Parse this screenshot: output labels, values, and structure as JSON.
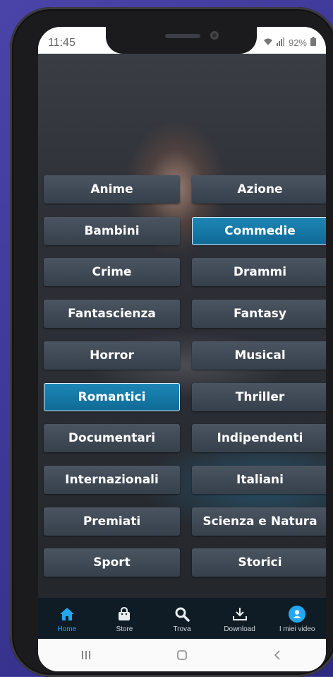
{
  "status": {
    "time": "11:45",
    "battery": "92%"
  },
  "genres": [
    {
      "label": "Anime",
      "selected": false
    },
    {
      "label": "Azione",
      "selected": false
    },
    {
      "label": "Bambini",
      "selected": false
    },
    {
      "label": "Commedie",
      "selected": true
    },
    {
      "label": "Crime",
      "selected": false
    },
    {
      "label": "Drammi",
      "selected": false
    },
    {
      "label": "Fantascienza",
      "selected": false
    },
    {
      "label": "Fantasy",
      "selected": false
    },
    {
      "label": "Horror",
      "selected": false
    },
    {
      "label": "Musical",
      "selected": false
    },
    {
      "label": "Romantici",
      "selected": true
    },
    {
      "label": "Thriller",
      "selected": false
    },
    {
      "label": "Documentari",
      "selected": false
    },
    {
      "label": "Indipendenti",
      "selected": false
    },
    {
      "label": "Internazionali",
      "selected": false
    },
    {
      "label": "Italiani",
      "selected": false
    },
    {
      "label": "Premiati",
      "selected": false
    },
    {
      "label": "Scienza e Natura",
      "selected": false
    },
    {
      "label": "Sport",
      "selected": false
    },
    {
      "label": "Storici",
      "selected": false
    }
  ],
  "nav": {
    "items": [
      {
        "label": "Home",
        "icon": "home-icon",
        "active": true
      },
      {
        "label": "Store",
        "icon": "shopping-bag-icon",
        "active": false
      },
      {
        "label": "Trova",
        "icon": "search-icon",
        "active": false
      },
      {
        "label": "Download",
        "icon": "download-icon",
        "active": false
      },
      {
        "label": "I miei video",
        "icon": "profile-icon",
        "active": false
      }
    ]
  },
  "colors": {
    "accent": "#22a7f0",
    "selected_button": "#1d86b5",
    "button": "#3f4955",
    "nav_background": "#0f1b25",
    "outer_background": "#3c3795"
  }
}
